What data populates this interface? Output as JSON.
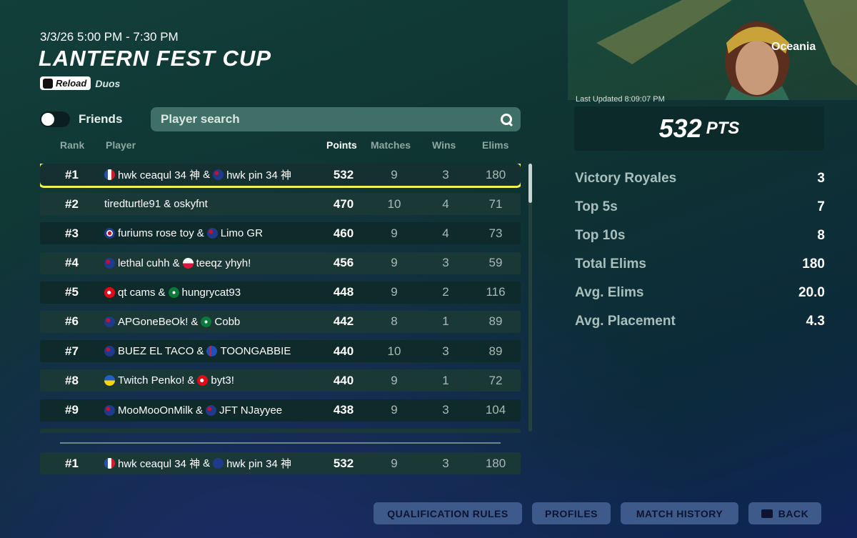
{
  "header": {
    "date_time": "3/3/26 5:00 PM - 7:30 PM",
    "title": "LANTERN FEST CUP",
    "mode_badge": "Reload",
    "mode_sub": "Duos"
  },
  "filters": {
    "friends_label": "Friends",
    "friends_toggle_on": false,
    "search_placeholder": "Player search"
  },
  "columns": {
    "rank": "Rank",
    "player": "Player",
    "points": "Points",
    "matches": "Matches",
    "wins": "Wins",
    "elims": "Elims"
  },
  "leaderboard": [
    {
      "rank": "#1",
      "p1": "hwk ceaqul 34 神",
      "f1": "france",
      "amp": "&",
      "p2": "hwk pin 34 神",
      "f2": "australia",
      "points": "532",
      "matches": "9",
      "wins": "3",
      "elims": "180"
    },
    {
      "rank": "#2",
      "p1": "tiredturtle91",
      "f1": "",
      "amp": "&",
      "p2": "oskyfnt",
      "f2": "",
      "points": "470",
      "matches": "10",
      "wins": "4",
      "elims": "71"
    },
    {
      "rank": "#3",
      "p1": "furiums rose toy",
      "f1": "uk",
      "amp": "&",
      "p2": "Limo GR",
      "f2": "australia",
      "points": "460",
      "matches": "9",
      "wins": "4",
      "elims": "73"
    },
    {
      "rank": "#4",
      "p1": "lethal cuhh",
      "f1": "australia",
      "amp": "&",
      "p2": "teeqz yhyh!",
      "f2": "poland",
      "points": "456",
      "matches": "9",
      "wins": "3",
      "elims": "59"
    },
    {
      "rank": "#5",
      "p1": "qt cams",
      "f1": "turkey",
      "amp": "&",
      "p2": "hungrycat93",
      "f2": "saudi",
      "points": "448",
      "matches": "9",
      "wins": "2",
      "elims": "116"
    },
    {
      "rank": "#6",
      "p1": "APGoneBeOk!",
      "f1": "australia",
      "amp": "&",
      "p2": "Cobb",
      "f2": "saudi",
      "points": "442",
      "matches": "8",
      "wins": "1",
      "elims": "89"
    },
    {
      "rank": "#7",
      "p1": "BUEZ EL TACO",
      "f1": "australia",
      "amp": "&",
      "p2": "TOONGABBIE",
      "f2": "iceland",
      "points": "440",
      "matches": "10",
      "wins": "3",
      "elims": "89"
    },
    {
      "rank": "#8",
      "p1": "Twitch Penko!",
      "f1": "ukraine",
      "amp": "&",
      "p2": "byt3!",
      "f2": "turkey",
      "points": "440",
      "matches": "9",
      "wins": "1",
      "elims": "72"
    },
    {
      "rank": "#9",
      "p1": "MooMooOnMilk",
      "f1": "australia",
      "amp": "&",
      "p2": "JFT NJayyee",
      "f2": "australia",
      "points": "438",
      "matches": "9",
      "wins": "3",
      "elims": "104"
    }
  ],
  "my_row": {
    "rank": "#1",
    "p1": "hwk ceaqul 34 神",
    "amp": "&",
    "p2": "hwk pin 34 神",
    "points": "532",
    "matches": "9",
    "wins": "3",
    "elims": "180"
  },
  "flag_colors": {
    "france": "#2a4fb0",
    "australia": "#1f3a8a",
    "uk": "#c8102e",
    "poland": "#ffffff",
    "turkey": "#e30a17",
    "saudi": "#0a7a3a",
    "iceland": "#1f4fb8",
    "ukraine": "#ffd500"
  },
  "summary": {
    "region": "Oceania",
    "last_updated": "Last Updated 8:09:07 PM",
    "points_value": "532",
    "points_unit": "PTS",
    "stats": [
      {
        "label": "Victory Royales",
        "value": "3"
      },
      {
        "label": "Top 5s",
        "value": "7"
      },
      {
        "label": "Top 10s",
        "value": "8"
      },
      {
        "label": "Total Elims",
        "value": "180"
      },
      {
        "label": "Avg. Elims",
        "value": "20.0"
      },
      {
        "label": "Avg. Placement",
        "value": "4.3"
      }
    ]
  },
  "buttons": {
    "qualification_rules": "QUALIFICATION RULES",
    "profiles": "PROFILES",
    "match_history": "MATCH HISTORY",
    "back": "BACK"
  }
}
